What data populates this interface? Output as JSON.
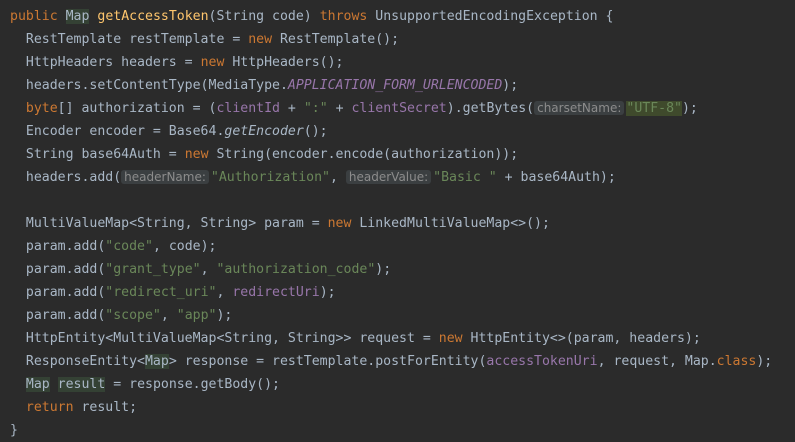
{
  "colors": {
    "background": "#2b2b2b",
    "keyword": "#cc7832",
    "method_declaration": "#ffc66d",
    "string": "#6a8759",
    "field": "#9876aa",
    "default_text": "#a9b7c6",
    "inlay_hint_bg": "#3b3f41"
  },
  "tokens": {
    "l1": {
      "kw_public": "public",
      "type_map": "Map",
      "method": "getAccessToken",
      "params": "(String code) ",
      "kw_throws": "throws",
      "tail": " UnsupportedEncodingException {"
    },
    "l2": {
      "a": "RestTemplate restTemplate = ",
      "kw_new": "new",
      "b": " RestTemplate();"
    },
    "l3": {
      "a": "HttpHeaders headers = ",
      "kw_new": "new",
      "b": " HttpHeaders();"
    },
    "l4": {
      "a": "headers.setContentType(MediaType.",
      "const": "APPLICATION_FORM_URLENCODED",
      "b": ");"
    },
    "l5": {
      "kw_byte": "byte",
      "a": "[] authorization = (",
      "fld_client_id": "clientId",
      "b": " + ",
      "str_colon": "\":\"",
      "c": " + ",
      "fld_client_secret": "clientSecret",
      "d": ").getBytes(",
      "hint": "charsetName:",
      "str_utf8": "\"UTF-8\"",
      "e": ");"
    },
    "l6": {
      "a": "Encoder encoder = Base64.",
      "it_method": "getEncoder",
      "b": "();"
    },
    "l7": {
      "a": "String base64Auth = ",
      "kw_new": "new",
      "b": " String(encoder.encode(authorization));"
    },
    "l8": {
      "a": "headers.add(",
      "hint1": "headerName:",
      "str1": "\"Authorization\"",
      "b": ", ",
      "hint2": "headerValue:",
      "str2": "\"Basic \"",
      "c": " + base64Auth);"
    },
    "l10": {
      "a": "MultiValueMap<String, String> param = ",
      "kw_new": "new",
      "b": " LinkedMultiValueMap<>();"
    },
    "l11": {
      "a": "param.add(",
      "s1": "\"code\"",
      "b": ", code);"
    },
    "l12": {
      "a": "param.add(",
      "s1": "\"grant_type\"",
      "b": ", ",
      "s2": "\"authorization_code\"",
      "c": ");"
    },
    "l13": {
      "a": "param.add(",
      "s1": "\"redirect_uri\"",
      "b": ", ",
      "fld": "redirectUri",
      "c": ");"
    },
    "l14": {
      "a": "param.add(",
      "s1": "\"scope\"",
      "b": ", ",
      "s2": "\"app\"",
      "c": ");"
    },
    "l15": {
      "a": "HttpEntity<MultiValueMap<String, String>> request = ",
      "kw_new": "new",
      "b": " HttpEntity<>(param, headers);"
    },
    "l16": {
      "a": "ResponseEntity<",
      "type_map": "Map",
      "b": "> response = restTemplate.postForEntity(",
      "fld": "accessTokenUri",
      "c": ", request, Map.",
      "kw_class": "class",
      "d": ");"
    },
    "l17": {
      "type_map": "Map",
      "a": " ",
      "var_result": "result",
      "b": " = response.getBody();"
    },
    "l18": {
      "kw_return": "return",
      "a": " result;"
    },
    "l19": {
      "a": "}"
    }
  }
}
